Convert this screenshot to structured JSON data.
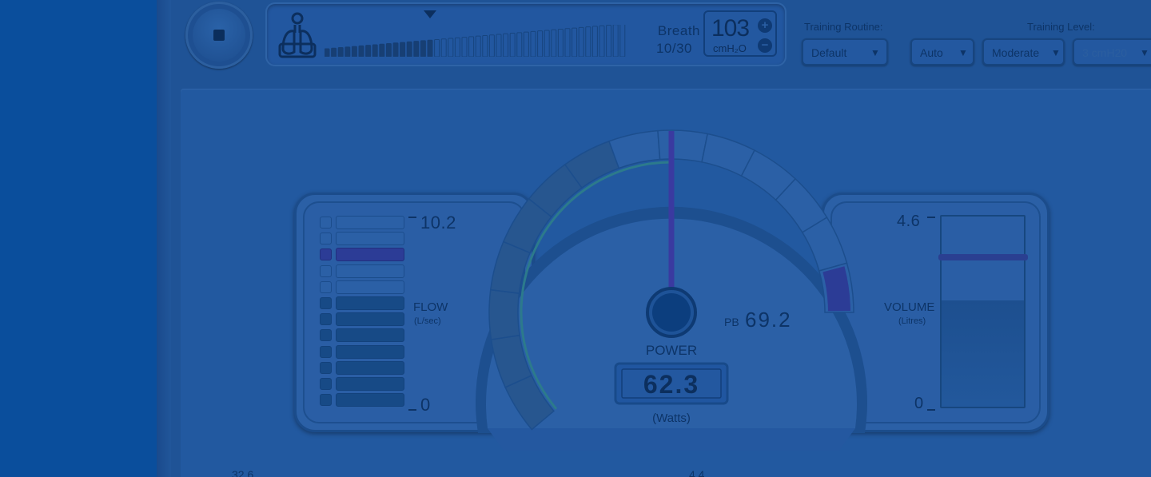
{
  "breath": {
    "label": "Breath",
    "count": "10/30"
  },
  "pressure": {
    "value": "103",
    "unit": "cmH₂O",
    "plus_label": "+",
    "minus_label": "−"
  },
  "training": {
    "routine_label": "Training Routine:",
    "routine_value": "Default",
    "mode_value": "Auto",
    "level_label": "Training Level:",
    "level_value": "Moderate",
    "pressure_value": "3 cmH20",
    "arrow": "▼"
  },
  "flow": {
    "title": "FLOW",
    "unit": "(L/sec)",
    "max": "10.2",
    "min": "0"
  },
  "volume": {
    "title": "VOLUME",
    "unit": "(Litres)",
    "max": "4.6",
    "min": "0"
  },
  "gauge": {
    "title": "POWER",
    "value": "62.3",
    "unit": "(Watts)",
    "pb_label": "PB",
    "pb_value": "69.2"
  },
  "bottom": {
    "left_value": "32.6",
    "mid_value": "4.4"
  },
  "icons": {
    "stop": "stop-icon",
    "lungs": "lungs-icon",
    "triangle": "triangle-marker-icon"
  },
  "colors": {
    "background": "#1f5296",
    "left_panel": "#0a4e9c",
    "needle": "#3a3aa0",
    "pb_bar": "#2c3c96"
  }
}
